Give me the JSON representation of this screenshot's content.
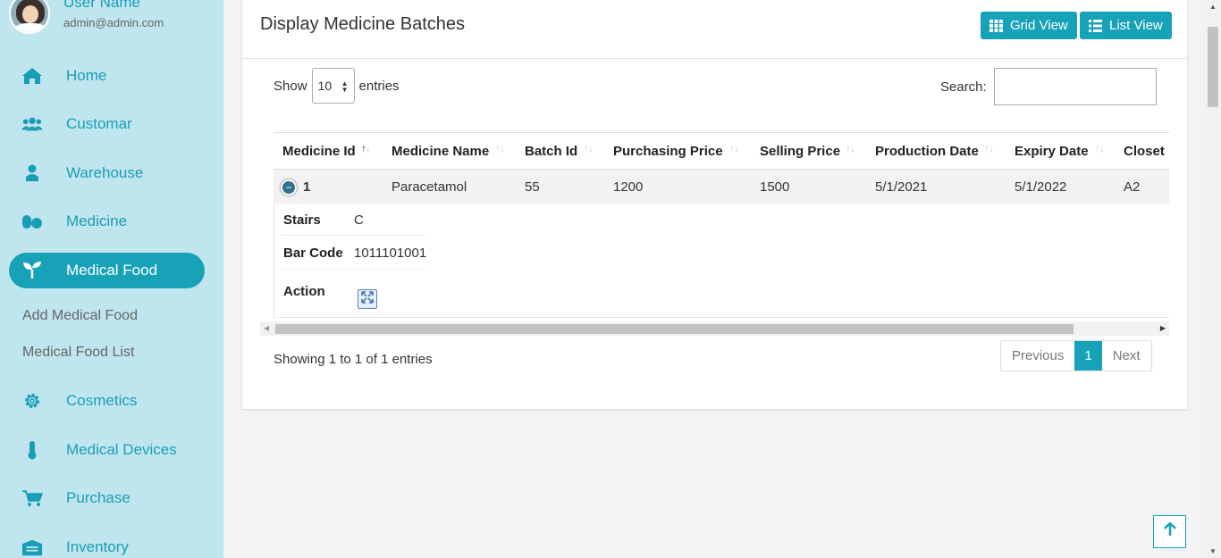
{
  "user": {
    "name": "User Name",
    "email": "admin@admin.com"
  },
  "nav": {
    "home": "Home",
    "customer": "Customar",
    "warehouse": "Warehouse",
    "medicine": "Medicine",
    "medical_food": "Medical Food",
    "add_medical_food": "Add Medical Food",
    "medical_food_list": "Medical Food List",
    "cosmetics": "Cosmetics",
    "medical_devices": "Medical Devices",
    "purchase": "Purchase",
    "inventory": "Inventory"
  },
  "card": {
    "title": "Display Medicine Batches",
    "grid_view": "Grid View",
    "list_view": "List View"
  },
  "length": {
    "show": "Show",
    "value": "10",
    "entries": "entries"
  },
  "search": {
    "label": "Search:",
    "value": ""
  },
  "table": {
    "headers": [
      "Medicine Id",
      "Medicine Name",
      "Batch Id",
      "Purchasing Price",
      "Selling Price",
      "Production Date",
      "Expiry Date",
      "Closet"
    ],
    "row": {
      "medicine_id": "1",
      "medicine_name": "Paracetamol",
      "batch_id": "55",
      "purchasing_price": "1200",
      "selling_price": "1500",
      "production_date": "5/1/2021",
      "expiry_date": "5/1/2022",
      "closet": "A2"
    },
    "child": {
      "stairs_label": "Stairs",
      "stairs_value": "C",
      "barcode_label": "Bar Code",
      "barcode_value": "1011101001",
      "action_label": "Action"
    }
  },
  "info": "Showing 1 to 1 of 1 entries",
  "pagination": {
    "previous": "Previous",
    "current": "1",
    "next": "Next"
  },
  "colors": {
    "accent": "#17a2b8",
    "sidebar_bg": "#bfe6ee"
  },
  "icons": [
    "home-icon",
    "users-icon",
    "user-icon",
    "pills-icon",
    "seedling-icon",
    "gear-icon",
    "thermometer-icon",
    "cart-icon",
    "warehouse-icon",
    "grid-icon",
    "list-icon",
    "expand-icon",
    "arrow-up-icon"
  ]
}
